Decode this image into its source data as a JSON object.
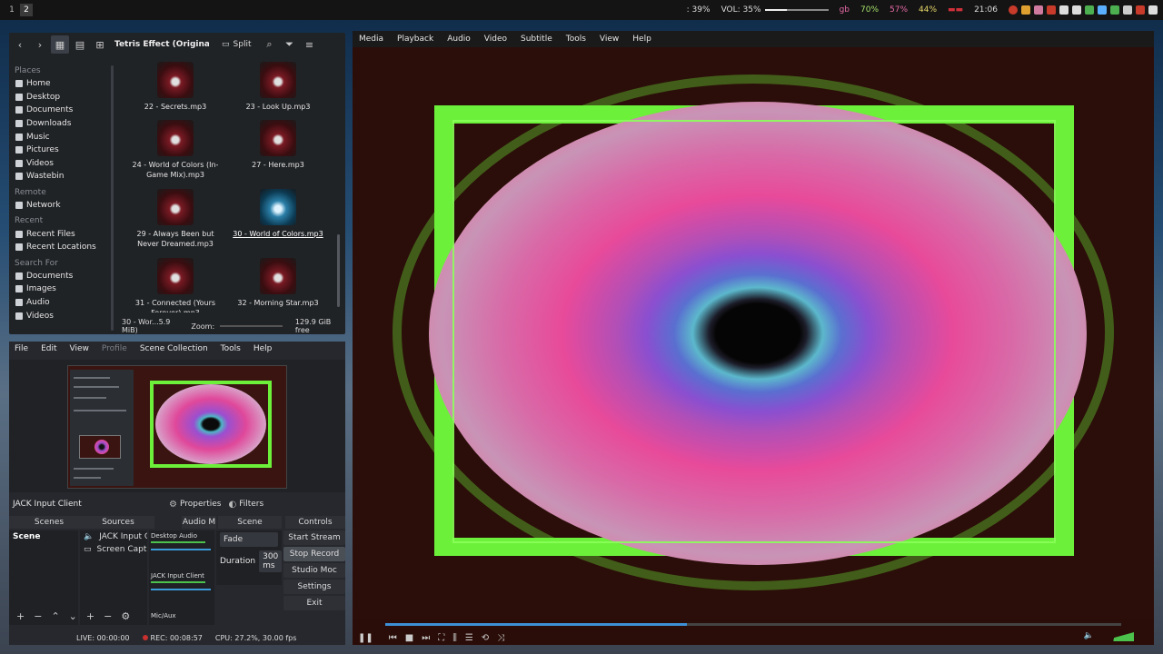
{
  "topbar": {
    "workspaces": [
      "1",
      "2"
    ],
    "status": {
      "brightness": ": 39%",
      "volume": "VOL: 35%",
      "volume_level": 0.35,
      "gb": "gb",
      "cpu": "70%",
      "mem": "57%",
      "temp": "44%",
      "clock": "21:06"
    }
  },
  "file_manager": {
    "path": "Tetris Effect (Original Sou",
    "split_label": "Split",
    "sidebar": [
      {
        "type": "header",
        "label": "Places"
      },
      {
        "type": "item",
        "label": "Home",
        "icon": "home-icon"
      },
      {
        "type": "item",
        "label": "Desktop",
        "icon": "desktop-icon"
      },
      {
        "type": "item",
        "label": "Documents",
        "icon": "documents-icon"
      },
      {
        "type": "item",
        "label": "Downloads",
        "icon": "downloads-icon"
      },
      {
        "type": "item",
        "label": "Music",
        "icon": "music-icon"
      },
      {
        "type": "item",
        "label": "Pictures",
        "icon": "pictures-icon"
      },
      {
        "type": "item",
        "label": "Videos",
        "icon": "videos-icon"
      },
      {
        "type": "item",
        "label": "Wastebin",
        "icon": "trash-icon"
      },
      {
        "type": "header",
        "label": "Remote"
      },
      {
        "type": "item",
        "label": "Network",
        "icon": "network-icon"
      },
      {
        "type": "header",
        "label": "Recent"
      },
      {
        "type": "item",
        "label": "Recent Files",
        "icon": "recent-files-icon"
      },
      {
        "type": "item",
        "label": "Recent Locations",
        "icon": "recent-locations-icon"
      },
      {
        "type": "header",
        "label": "Search For"
      },
      {
        "type": "item",
        "label": "Documents",
        "icon": "documents-icon"
      },
      {
        "type": "item",
        "label": "Images",
        "icon": "images-icon"
      },
      {
        "type": "item",
        "label": "Audio",
        "icon": "audio-icon"
      },
      {
        "type": "item",
        "label": "Videos",
        "icon": "videos-icon"
      }
    ],
    "files": [
      {
        "name": "22 - Secrets.mp3"
      },
      {
        "name": "23 - Look Up.mp3"
      },
      {
        "name": "24 - World of Colors (In-Game Mix).mp3"
      },
      {
        "name": "27 - Here.mp3"
      },
      {
        "name": "29 - Always Been but Never Dreamed.mp3"
      },
      {
        "name": "30 - World of Colors.mp3",
        "selected": true
      },
      {
        "name": "31 - Connected (Yours Forever).mp3"
      },
      {
        "name": "32 - Morning Star.mp3"
      }
    ],
    "statusbar": {
      "selection": "30 - Wor...5.9 MiB)",
      "zoom_label": "Zoom:",
      "free_space": "129.9 GiB free"
    }
  },
  "obs": {
    "menu": [
      "File",
      "Edit",
      "View",
      "Profile",
      "Scene Collection",
      "Tools",
      "Help"
    ],
    "menu_disabled": [
      "Profile"
    ],
    "source_name": "JACK Input Client",
    "properties_label": "Properties",
    "filters_label": "Filters",
    "docks": {
      "scenes_title": "Scenes",
      "sources_title": "Sources",
      "mixer_title": "Audio M",
      "transitions_title": "Scene Transition:",
      "controls_title": "Controls"
    },
    "scenes": [
      "Scene"
    ],
    "sources": [
      {
        "name": "JACK Input Cli",
        "icon": "speaker-icon"
      },
      {
        "name": "Screen Captur",
        "icon": "monitor-icon"
      }
    ],
    "mixer": [
      "Desktop Audio",
      "JACK Input Client",
      "Mic/Aux"
    ],
    "transition": {
      "type": "Fade",
      "duration_label": "Duration",
      "duration_value": "300 ms"
    },
    "controls": [
      "Start Stream",
      "Stop Record",
      "Studio Moc",
      "Settings",
      "Exit"
    ],
    "status": {
      "live": "LIVE: 00:00:00",
      "rec": "REC: 00:08:57",
      "cpu": "CPU: 27.2%, 30.00 fps"
    }
  },
  "media_player": {
    "menu": [
      "Media",
      "Playback",
      "Audio",
      "Video",
      "Subtitle",
      "Tools",
      "View",
      "Help"
    ],
    "seek_progress": 0.41,
    "accent": "#3d8fd6"
  }
}
